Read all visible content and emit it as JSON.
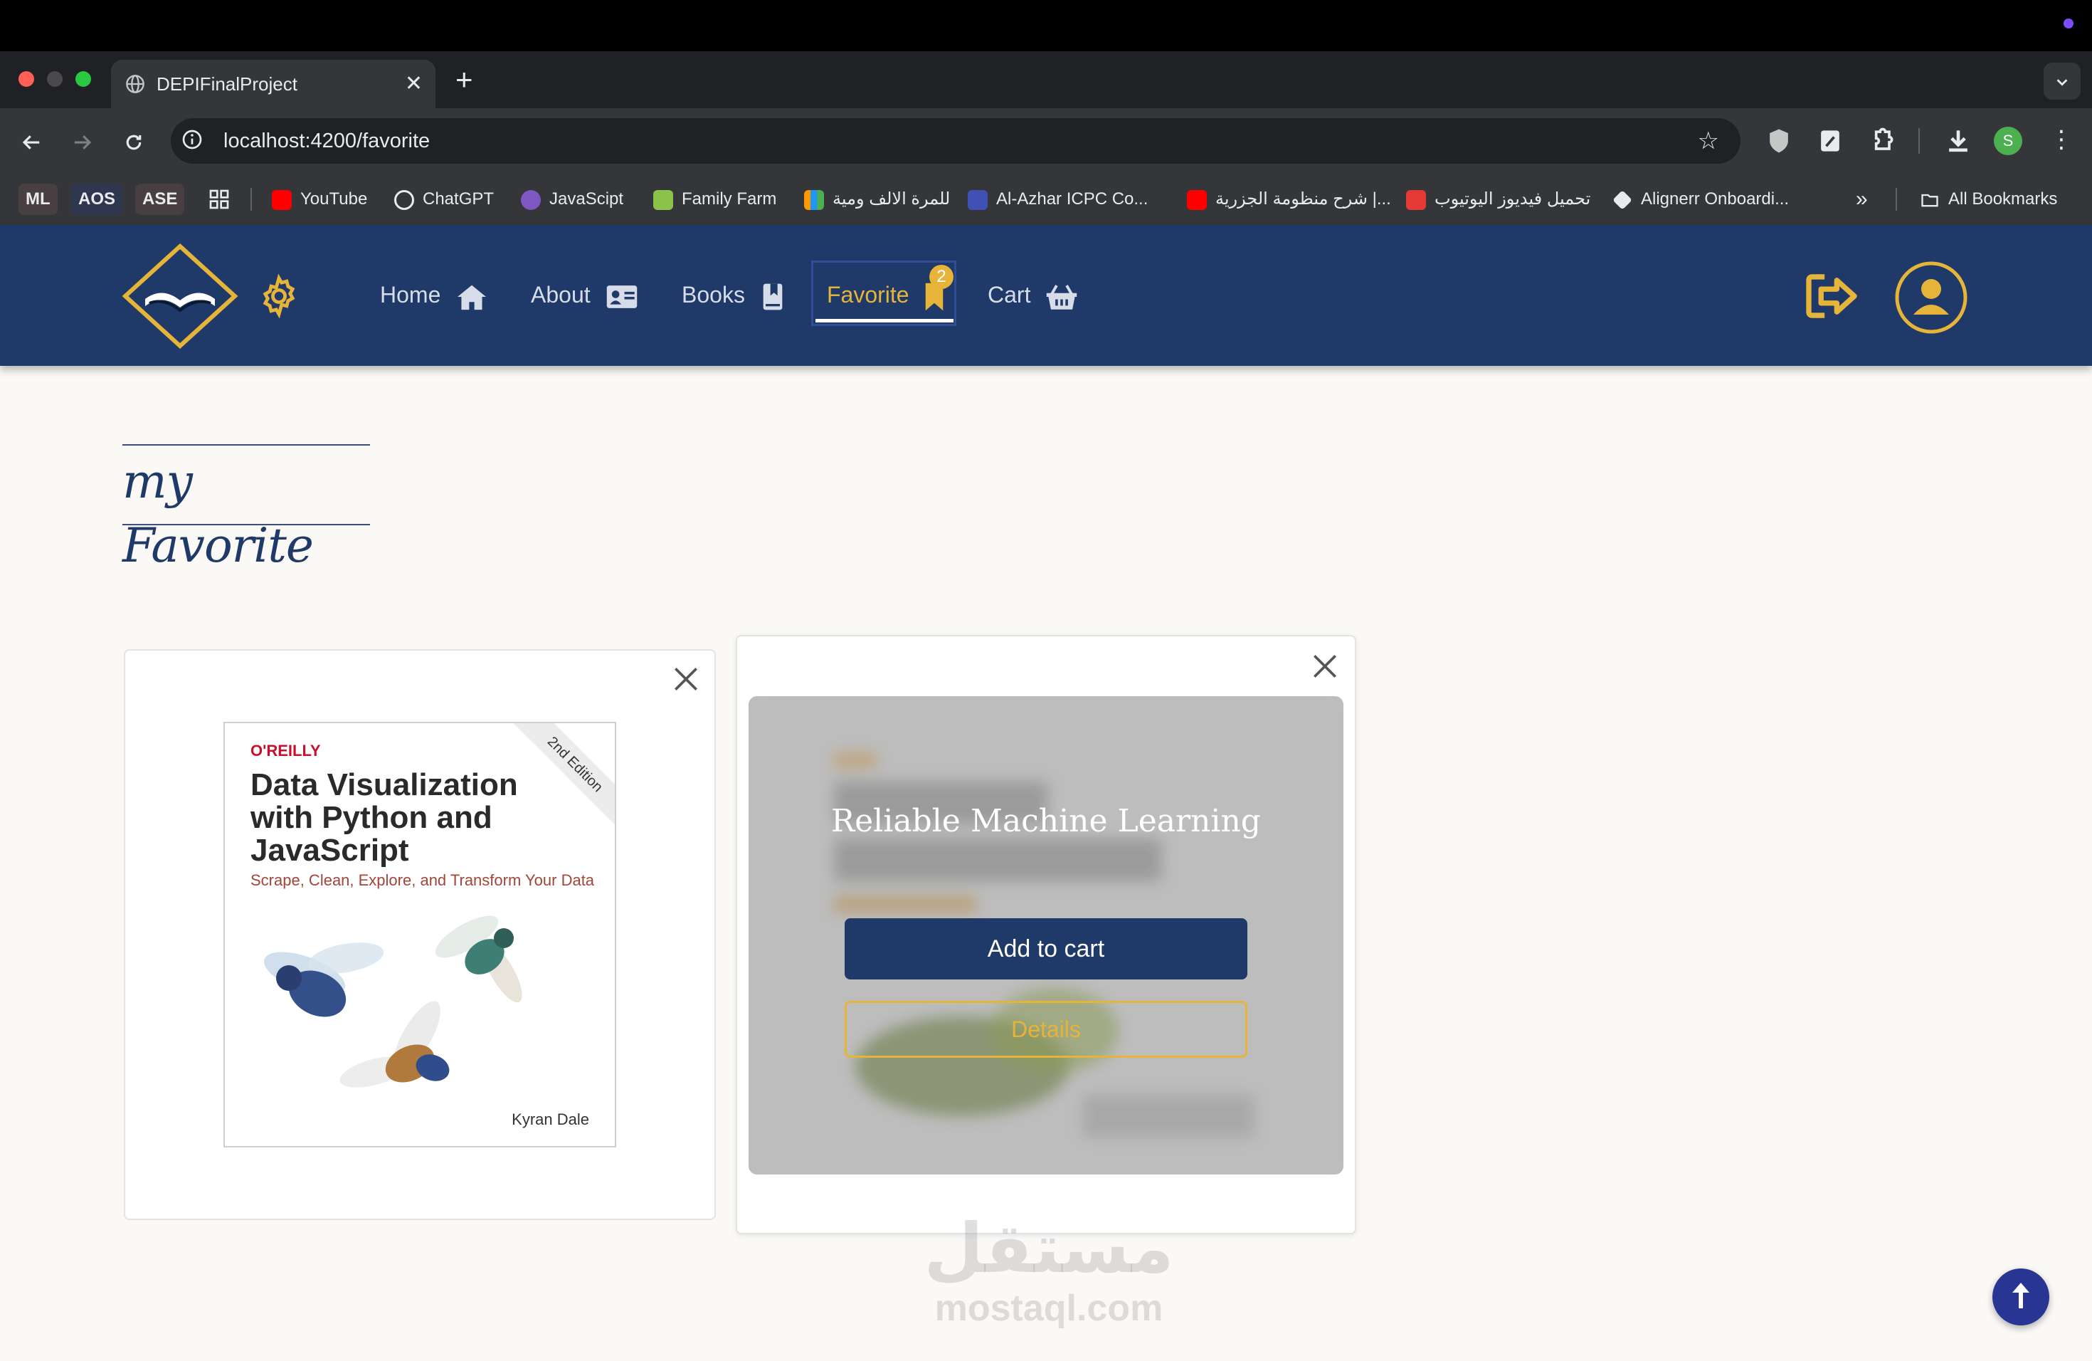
{
  "browser": {
    "tab_title": "DEPIFinalProject",
    "tab_close": "✕",
    "new_tab": "+",
    "url": "localhost:4200/favorite",
    "profile_initial": "S"
  },
  "bookmarks": [
    {
      "label": "ML"
    },
    {
      "label": "AOS"
    },
    {
      "label": "ASE"
    },
    {
      "label": "YouTube"
    },
    {
      "label": "ChatGPT"
    },
    {
      "label": "JavaScipt"
    },
    {
      "label": "Family Farm"
    },
    {
      "label": "للمرة الالف ومية"
    },
    {
      "label": "Al-Azhar ICPC Co..."
    },
    {
      "label": "شرح منظومة الجزرية |..."
    },
    {
      "label": "تحميل فيديوز اليوتيوب"
    },
    {
      "label": "Alignerr Onboardi..."
    },
    {
      "label": "All Bookmarks"
    }
  ],
  "navbar": {
    "links": {
      "home": "Home",
      "about": "About",
      "books": "Books",
      "favorite": "Favorite",
      "cart": "Cart"
    },
    "favorite_count": "2",
    "accent_color": "#e7b43a",
    "bar_color": "#1f3a68"
  },
  "page": {
    "title": "my Favorite"
  },
  "favorites": [
    {
      "cover": {
        "publisher": "O'REILLY",
        "title": "Data Visualization with Python and JavaScript",
        "subtitle": "Scrape, Clean, Explore, and Transform Your Data",
        "edition": "2nd Edition",
        "author": "Kyran Dale"
      }
    },
    {
      "title": "Reliable Machine Learning",
      "add_to_cart": "Add to cart",
      "details": "Details"
    }
  ],
  "watermark": {
    "arabic": "مستقل",
    "latin": "mostaql.com"
  }
}
